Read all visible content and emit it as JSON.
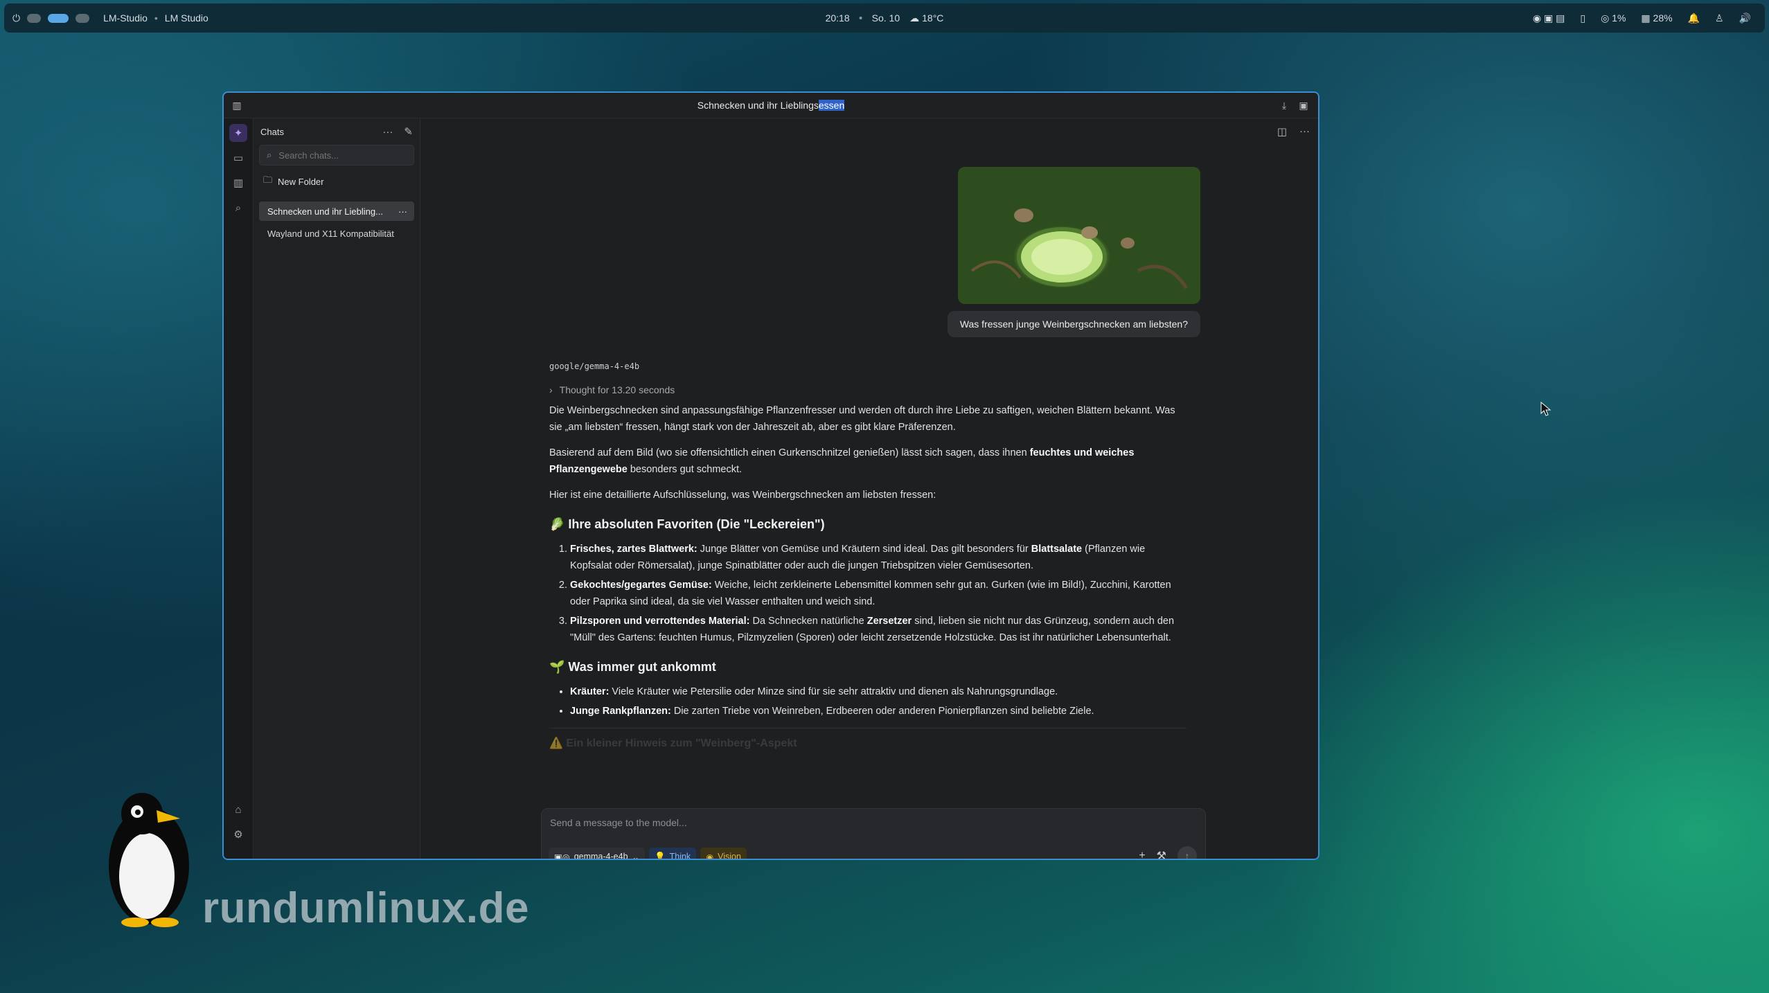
{
  "topbar": {
    "app_name": "LM-Studio",
    "window_name": "LM Studio",
    "time": "20:18",
    "date": "So. 10",
    "weather": "18°C",
    "cpu": "1%",
    "ram": "28%"
  },
  "window": {
    "title_prefix": "Schnecken und ihr Lieblings",
    "title_selected": "essen"
  },
  "sidebar": {
    "header": "Chats",
    "search_placeholder": "Search chats...",
    "new_folder": "New Folder",
    "chats": [
      {
        "label": "Schnecken und ihr Liebling..."
      },
      {
        "label": "Wayland und X11 Kompatibilität"
      }
    ]
  },
  "conversation": {
    "user_message": "Was fressen junge Weinbergschnecken am liebsten?",
    "model_tag": "google/gemma-4-e4b",
    "thought": "Thought for 13.20 seconds",
    "p1": "Die Weinbergschnecken sind anpassungsfähige Pflanzenfresser und werden oft durch ihre Liebe zu saftigen, weichen Blättern bekannt. Was sie „am liebsten“ fressen, hängt stark von der Jahreszeit ab, aber es gibt klare Präferenzen.",
    "p2_a": "Basierend auf dem Bild (wo sie offensichtlich einen Gurkenschnitzel genießen) lässt sich sagen, dass ihnen ",
    "p2_b": "feuchtes und weiches Pflanzengewebe",
    "p2_c": " besonders gut schmeckt.",
    "p3": "Hier ist eine detaillierte Aufschlüsselung, was Weinbergschnecken am liebsten fressen:",
    "h1": "🥬 Ihre absoluten Favoriten (Die \"Leckereien\")",
    "li1_b": "Frisches, zartes Blattwerk:",
    "li1_t": " Junge Blätter von Gemüse und Kräutern sind ideal. Das gilt besonders für ",
    "li1_b2": "Blattsalate",
    "li1_t2": " (Pflanzen wie Kopfsalat oder Römersalat), junge Spinatblätter oder auch die jungen Triebspitzen vieler Gemüsesorten.",
    "li2_b": "Gekochtes/gegartes Gemüse:",
    "li2_t": " Weiche, leicht zerkleinerte Lebensmittel kommen sehr gut an. Gurken (wie im Bild!), Zucchini, Karotten oder Paprika sind ideal, da sie viel Wasser enthalten und weich sind.",
    "li3_b": "Pilzsporen und verrottendes Material:",
    "li3_t": " Da Schnecken natürliche ",
    "li3_b2": "Zersetzer",
    "li3_t2": " sind, lieben sie nicht nur das Grünzeug, sondern auch den \"Müll\" des Gartens: feuchten Humus, Pilzmyzelien (Sporen) oder leicht zersetzende Holzstücke. Das ist ihr natürlicher Lebensunterhalt.",
    "h2": "🌱 Was immer gut ankommt",
    "ul1_b": "Kräuter:",
    "ul1_t": " Viele Kräuter wie Petersilie oder Minze sind für sie sehr attraktiv und dienen als Nahrungsgrundlage.",
    "ul2_b": "Junge Rankpflanzen:",
    "ul2_t": " Die zarten Triebe von Weinreben, Erdbeeren oder anderen Pionierpflanzen sind beliebte Ziele.",
    "faded_heading": "⚠️ Ein kleiner Hinweis zum \"Weinberg\"-Aspekt"
  },
  "composer": {
    "placeholder": "Send a message to the model...",
    "model": "gemma-4-e4b",
    "think": "Think",
    "vision": "Vision"
  },
  "watermark": "rundumlinux.de"
}
